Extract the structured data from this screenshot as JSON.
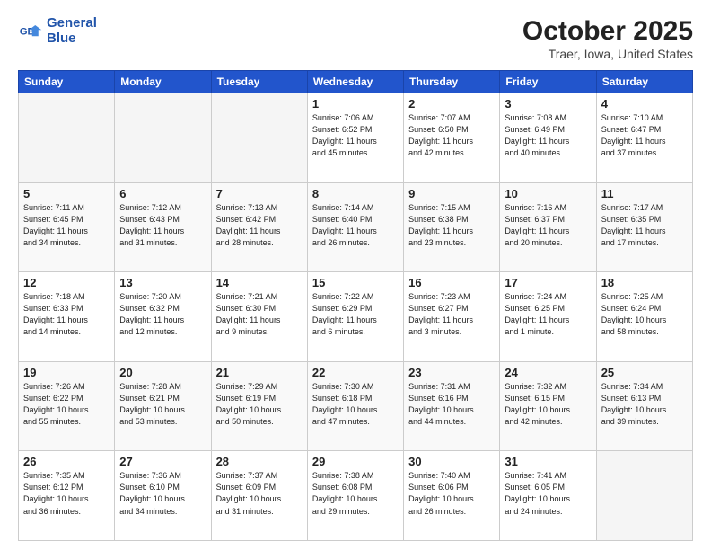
{
  "header": {
    "logo_line1": "General",
    "logo_line2": "Blue",
    "title": "October 2025",
    "subtitle": "Traer, Iowa, United States"
  },
  "days_of_week": [
    "Sunday",
    "Monday",
    "Tuesday",
    "Wednesday",
    "Thursday",
    "Friday",
    "Saturday"
  ],
  "weeks": [
    [
      {
        "day": "",
        "info": ""
      },
      {
        "day": "",
        "info": ""
      },
      {
        "day": "",
        "info": ""
      },
      {
        "day": "1",
        "info": "Sunrise: 7:06 AM\nSunset: 6:52 PM\nDaylight: 11 hours\nand 45 minutes."
      },
      {
        "day": "2",
        "info": "Sunrise: 7:07 AM\nSunset: 6:50 PM\nDaylight: 11 hours\nand 42 minutes."
      },
      {
        "day": "3",
        "info": "Sunrise: 7:08 AM\nSunset: 6:49 PM\nDaylight: 11 hours\nand 40 minutes."
      },
      {
        "day": "4",
        "info": "Sunrise: 7:10 AM\nSunset: 6:47 PM\nDaylight: 11 hours\nand 37 minutes."
      }
    ],
    [
      {
        "day": "5",
        "info": "Sunrise: 7:11 AM\nSunset: 6:45 PM\nDaylight: 11 hours\nand 34 minutes."
      },
      {
        "day": "6",
        "info": "Sunrise: 7:12 AM\nSunset: 6:43 PM\nDaylight: 11 hours\nand 31 minutes."
      },
      {
        "day": "7",
        "info": "Sunrise: 7:13 AM\nSunset: 6:42 PM\nDaylight: 11 hours\nand 28 minutes."
      },
      {
        "day": "8",
        "info": "Sunrise: 7:14 AM\nSunset: 6:40 PM\nDaylight: 11 hours\nand 26 minutes."
      },
      {
        "day": "9",
        "info": "Sunrise: 7:15 AM\nSunset: 6:38 PM\nDaylight: 11 hours\nand 23 minutes."
      },
      {
        "day": "10",
        "info": "Sunrise: 7:16 AM\nSunset: 6:37 PM\nDaylight: 11 hours\nand 20 minutes."
      },
      {
        "day": "11",
        "info": "Sunrise: 7:17 AM\nSunset: 6:35 PM\nDaylight: 11 hours\nand 17 minutes."
      }
    ],
    [
      {
        "day": "12",
        "info": "Sunrise: 7:18 AM\nSunset: 6:33 PM\nDaylight: 11 hours\nand 14 minutes."
      },
      {
        "day": "13",
        "info": "Sunrise: 7:20 AM\nSunset: 6:32 PM\nDaylight: 11 hours\nand 12 minutes."
      },
      {
        "day": "14",
        "info": "Sunrise: 7:21 AM\nSunset: 6:30 PM\nDaylight: 11 hours\nand 9 minutes."
      },
      {
        "day": "15",
        "info": "Sunrise: 7:22 AM\nSunset: 6:29 PM\nDaylight: 11 hours\nand 6 minutes."
      },
      {
        "day": "16",
        "info": "Sunrise: 7:23 AM\nSunset: 6:27 PM\nDaylight: 11 hours\nand 3 minutes."
      },
      {
        "day": "17",
        "info": "Sunrise: 7:24 AM\nSunset: 6:25 PM\nDaylight: 11 hours\nand 1 minute."
      },
      {
        "day": "18",
        "info": "Sunrise: 7:25 AM\nSunset: 6:24 PM\nDaylight: 10 hours\nand 58 minutes."
      }
    ],
    [
      {
        "day": "19",
        "info": "Sunrise: 7:26 AM\nSunset: 6:22 PM\nDaylight: 10 hours\nand 55 minutes."
      },
      {
        "day": "20",
        "info": "Sunrise: 7:28 AM\nSunset: 6:21 PM\nDaylight: 10 hours\nand 53 minutes."
      },
      {
        "day": "21",
        "info": "Sunrise: 7:29 AM\nSunset: 6:19 PM\nDaylight: 10 hours\nand 50 minutes."
      },
      {
        "day": "22",
        "info": "Sunrise: 7:30 AM\nSunset: 6:18 PM\nDaylight: 10 hours\nand 47 minutes."
      },
      {
        "day": "23",
        "info": "Sunrise: 7:31 AM\nSunset: 6:16 PM\nDaylight: 10 hours\nand 44 minutes."
      },
      {
        "day": "24",
        "info": "Sunrise: 7:32 AM\nSunset: 6:15 PM\nDaylight: 10 hours\nand 42 minutes."
      },
      {
        "day": "25",
        "info": "Sunrise: 7:34 AM\nSunset: 6:13 PM\nDaylight: 10 hours\nand 39 minutes."
      }
    ],
    [
      {
        "day": "26",
        "info": "Sunrise: 7:35 AM\nSunset: 6:12 PM\nDaylight: 10 hours\nand 36 minutes."
      },
      {
        "day": "27",
        "info": "Sunrise: 7:36 AM\nSunset: 6:10 PM\nDaylight: 10 hours\nand 34 minutes."
      },
      {
        "day": "28",
        "info": "Sunrise: 7:37 AM\nSunset: 6:09 PM\nDaylight: 10 hours\nand 31 minutes."
      },
      {
        "day": "29",
        "info": "Sunrise: 7:38 AM\nSunset: 6:08 PM\nDaylight: 10 hours\nand 29 minutes."
      },
      {
        "day": "30",
        "info": "Sunrise: 7:40 AM\nSunset: 6:06 PM\nDaylight: 10 hours\nand 26 minutes."
      },
      {
        "day": "31",
        "info": "Sunrise: 7:41 AM\nSunset: 6:05 PM\nDaylight: 10 hours\nand 24 minutes."
      },
      {
        "day": "",
        "info": ""
      }
    ]
  ]
}
